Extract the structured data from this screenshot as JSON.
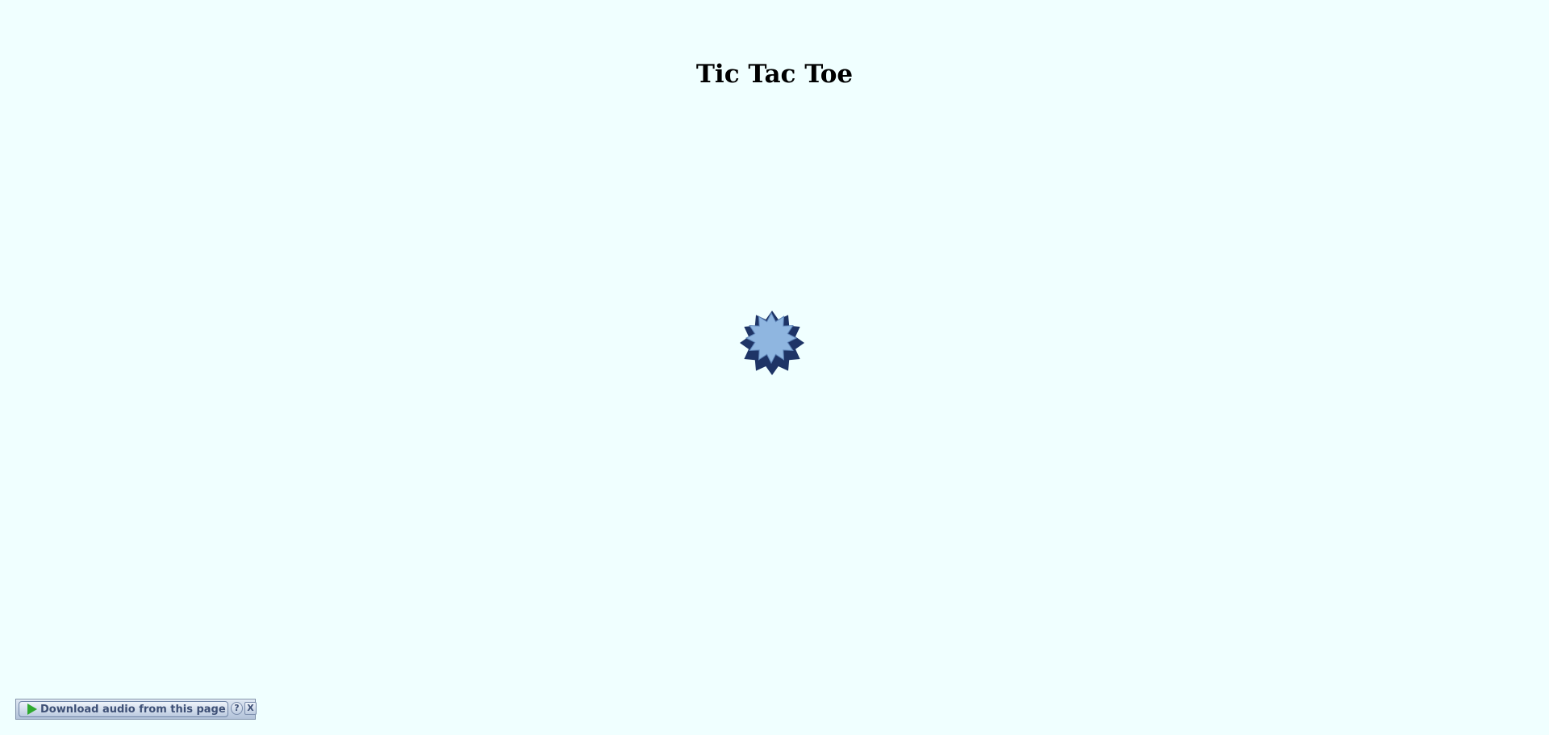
{
  "page": {
    "title": "Tic Tac Toe"
  },
  "loading_indicator": {
    "icon": "loading-starburst-icon",
    "colors": {
      "outer": "#1e3466",
      "inner": "#8fb6e0",
      "inner_edge": "#5f86ba"
    }
  },
  "audio_toolbar": {
    "download_label": "Download audio from this page",
    "help_label": "?",
    "close_label": "X",
    "play_icon": "play-icon",
    "colors": {
      "text": "#3d4f75",
      "play": "#2faa2f"
    }
  },
  "colors": {
    "background": "#f0ffff"
  }
}
